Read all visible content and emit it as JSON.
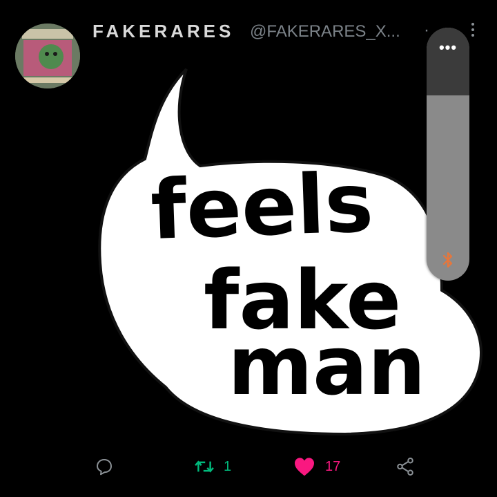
{
  "tweet": {
    "display_name": "FAKERARES",
    "handle": "@FAKERARES_X...",
    "separator": "·",
    "more_icon": "more-vertical-icon",
    "avatar_alt": "profile-avatar"
  },
  "media": {
    "meme_lines": [
      "feels",
      "fake",
      "man"
    ]
  },
  "side_panel": {
    "dots_icon": "more-horizontal-icon",
    "bottom_icon": "bluetooth-icon",
    "bottom_icon_color": "#e8763a",
    "fill_fraction": 0.73
  },
  "actions": {
    "reply_icon": "reply-icon",
    "retweet_icon": "retweet-icon",
    "retweet_count": "1",
    "like_icon": "heart-icon",
    "like_count": "17",
    "share_icon": "share-icon"
  },
  "colors": {
    "retweet": "#00ba7c",
    "like": "#f91880",
    "background": "#000000"
  }
}
